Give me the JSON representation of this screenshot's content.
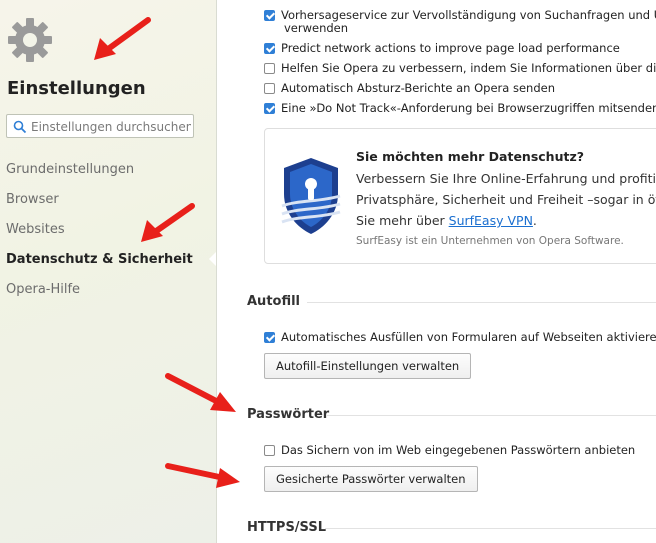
{
  "sidebar": {
    "title": "Einstellungen",
    "search_placeholder": "Einstellungen durchsuchen",
    "items": [
      {
        "label": "Grundeinstellungen",
        "active": false
      },
      {
        "label": "Browser",
        "active": false
      },
      {
        "label": "Websites",
        "active": false
      },
      {
        "label": "Datenschutz & Sicherheit",
        "active": true
      },
      {
        "label": "Opera-Hilfe",
        "active": false
      }
    ]
  },
  "privacy": {
    "options": [
      {
        "label": "Vorhersageservice zur Vervollständigung von Suchanfragen und URLs b",
        "label2": "verwenden",
        "checked": true
      },
      {
        "label": "Predict network actions to improve page load performance",
        "checked": true
      },
      {
        "label": "Helfen Sie Opera zu verbessern, indem Sie Informationen über die Ver",
        "checked": false
      },
      {
        "label": "Automatisch Absturz-Berichte an Opera senden",
        "checked": false
      },
      {
        "label": "Eine »Do Not Track«-Anforderung bei Browserzugriffen mitsenden",
        "checked": true
      }
    ]
  },
  "promo": {
    "title": "Sie möchten mehr Datenschutz?",
    "line1": "Verbessern Sie Ihre Online-Erfahrung und profitie",
    "line2": "Privatsphäre, Sicherheit und Freiheit –sogar in öf",
    "line3_prefix": "Sie mehr über ",
    "link": "SurfEasy VPN",
    "line3_suffix": ".",
    "footnote": "SurfEasy ist ein Unternehmen von Opera Software."
  },
  "autofill": {
    "heading": "Autofill",
    "option_label": "Automatisches Ausfüllen von Formularen auf Webseiten aktivieren",
    "option_checked": true,
    "button": "Autofill-Einstellungen verwalten"
  },
  "passwords": {
    "heading": "Passwörter",
    "option_label": "Das Sichern von im Web eingegebenen Passwörtern anbieten",
    "option_checked": false,
    "button": "Gesicherte Passwörter verwalten"
  },
  "https": {
    "heading": "HTTPS/SSL"
  },
  "colors": {
    "accent": "#2f7fd6",
    "link": "#1a6fd0",
    "annotation_arrow": "#e8201a"
  }
}
